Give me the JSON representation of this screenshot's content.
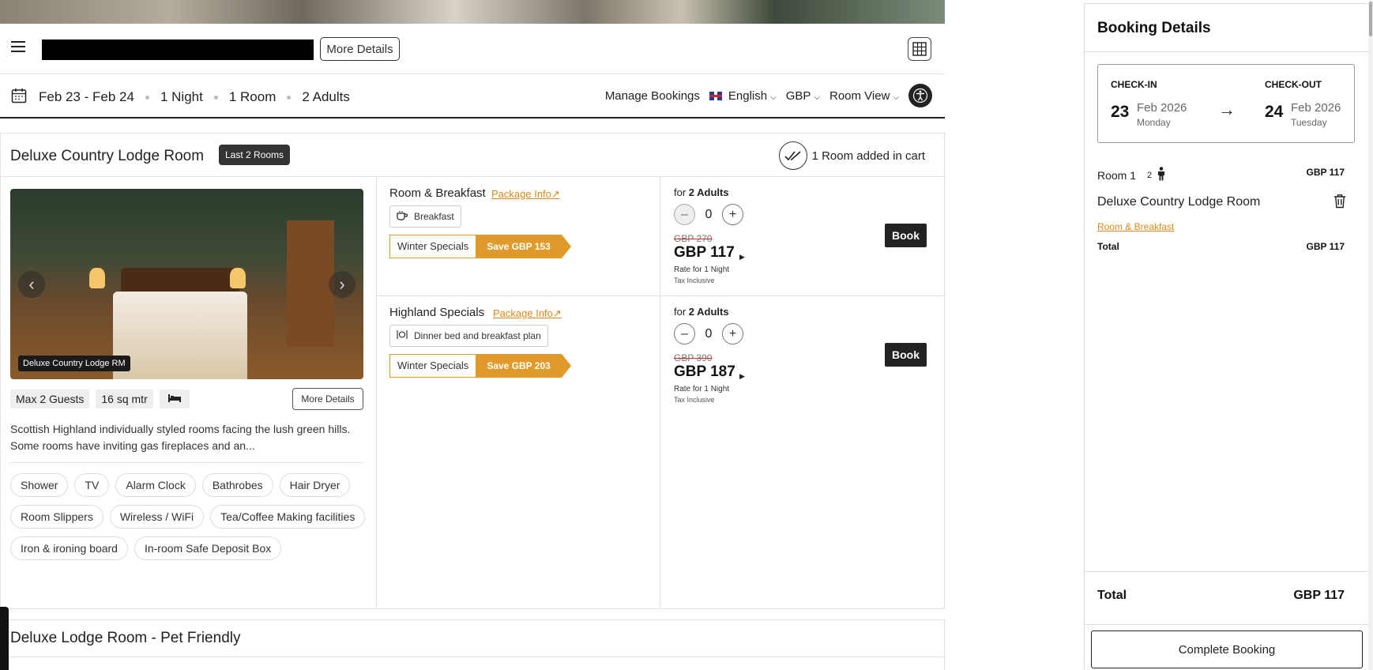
{
  "header": {
    "menu_icon": "hamburger-menu-icon",
    "more_details": "More Details",
    "grid_icon": "grid-view-icon"
  },
  "datebar": {
    "dates": "Feb 23 - Feb 24",
    "nights": "1 Night",
    "rooms": "1 Room",
    "adults": "2 Adults",
    "manage_bookings": "Manage Bookings",
    "language": "English",
    "currency": "GBP",
    "view": "Room View"
  },
  "room": {
    "title": "Deluxe Country Lodge Room",
    "badge": "Last 2 Rooms",
    "cart_status": "1 Room added in cart",
    "photo_caption": "Deluxe Country Lodge RM",
    "guests": "Max 2 Guests",
    "size": "16 sq mtr",
    "more_details": "More Details",
    "description": "Scottish Highland individually styled rooms facing the lush green hills. Some rooms have inviting gas fireplaces and an...",
    "amenities": [
      "Shower",
      "TV",
      "Alarm Clock",
      "Bathrobes",
      "Hair Dryer",
      "Room Slippers",
      "Wireless / WiFi",
      "Tea/Coffee Making facilities",
      "Iron & ironing board",
      "In-room Safe Deposit Box"
    ]
  },
  "rates": [
    {
      "name": "Room & Breakfast",
      "package_info": "Package Info",
      "meal": "Breakfast",
      "offer": "Winter Specials",
      "save": "Save GBP 153",
      "for_prefix": "for",
      "adults": "2 Adults",
      "qty": "0",
      "old_price": "GBP 270",
      "price": "GBP 117",
      "rate_note": "Rate for 1 Night",
      "tax": "Tax Inclusive",
      "book": "Book"
    },
    {
      "name": "Highland Specials",
      "package_info": "Package Info",
      "meal": "Dinner bed and breakfast plan",
      "offer": "Winter Specials",
      "save": "Save GBP 203",
      "for_prefix": "for",
      "adults": "2 Adults",
      "qty": "0",
      "old_price": "GBP 390",
      "price": "GBP 187",
      "rate_note": "Rate for 1 Night",
      "tax": "Tax Inclusive",
      "book": "Book"
    }
  ],
  "next_room": {
    "title": "Deluxe Lodge Room - Pet Friendly"
  },
  "panel": {
    "title": "Booking Details",
    "checkin_label": "CHECK-IN",
    "checkin_day": "23",
    "checkin_month": "Feb 2026",
    "checkin_weekday": "Monday",
    "checkout_label": "CHECK-OUT",
    "checkout_day": "24",
    "checkout_month": "Feb 2026",
    "checkout_weekday": "Tuesday",
    "room_label": "Room 1",
    "room_guests": "2",
    "room_price": "GBP 117",
    "room_name": "Deluxe Country Lodge Room",
    "rate_name": "Room & Breakfast",
    "total_label": "Total",
    "total_value": "GBP 117",
    "grand_total_label": "Total",
    "grand_total_value": "GBP 117",
    "complete": "Complete Booking"
  },
  "colors": {
    "accent": "#e09a2a",
    "dark": "#222222"
  }
}
